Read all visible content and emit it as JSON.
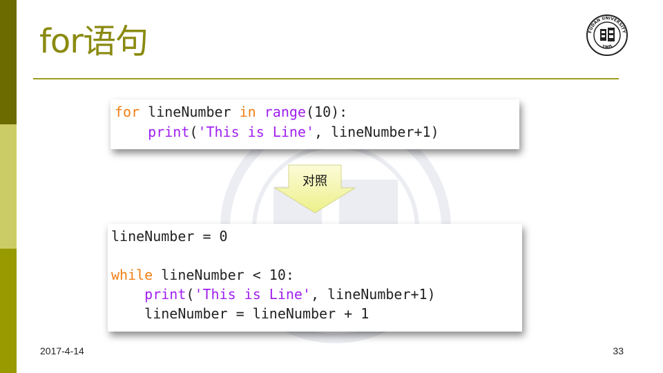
{
  "slide": {
    "title": "for语句",
    "date": "2017-4-14",
    "page_number": "33",
    "arrow_label": "对照"
  },
  "logo": {
    "ring_text": "FUDAN UNIVERSITY",
    "year": "1905"
  },
  "colors": {
    "accent": "#9c9c1c",
    "sidebar_dark": "#6b6b00",
    "sidebar_light": "#cccc66",
    "sidebar_mid": "#999900",
    "keyword_orange": "#f07f15",
    "builtin_purple": "#a020f0",
    "arrow_fill": "#f4f5a8"
  },
  "code_for": {
    "line1": {
      "kw_for": "for",
      "var": " lineNumber ",
      "kw_in": "in",
      "sp": " ",
      "fn_range": "range",
      "rest": "(10):"
    },
    "line2": {
      "indent": "    ",
      "fn_print": "print",
      "open": "(",
      "str": "'This is Line'",
      "rest": ", lineNumber+1)"
    }
  },
  "code_while": {
    "line1": "lineNumber = 0",
    "line3": {
      "kw_while": "while",
      "rest": " lineNumber < 10:"
    },
    "line4": {
      "indent": "    ",
      "fn_print": "print",
      "open": "(",
      "str": "'This is Line'",
      "rest": ", lineNumber+1)"
    },
    "line5": "    lineNumber = lineNumber + 1"
  }
}
